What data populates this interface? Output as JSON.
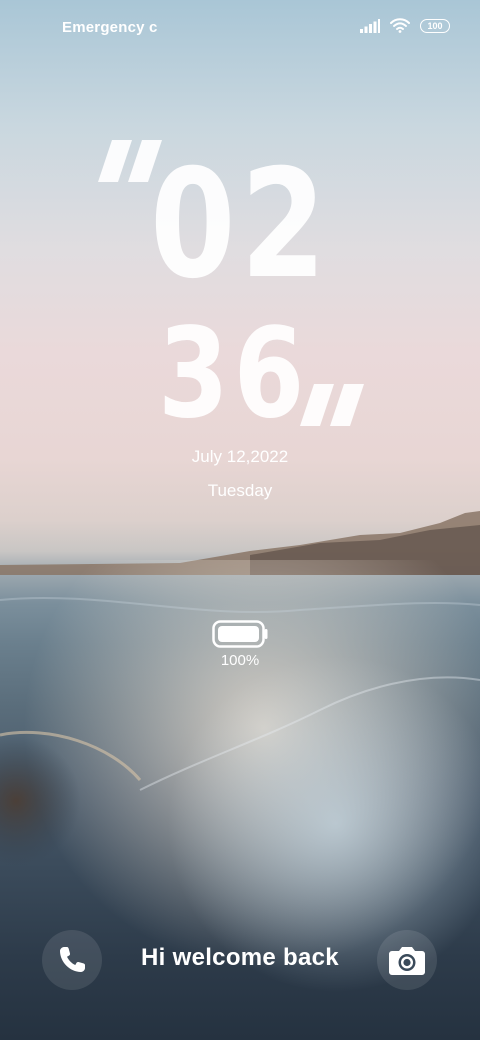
{
  "status_bar": {
    "carrier_text": "Emergency c",
    "battery_level": "100",
    "icons": [
      "signal-icon",
      "wifi-icon",
      "battery-icon"
    ]
  },
  "clock": {
    "hours": "02",
    "minutes": "36"
  },
  "date": {
    "date_text": "July 12,2022",
    "weekday_text": "Tuesday"
  },
  "charging": {
    "percent_text": "100%",
    "level": 1.0
  },
  "bottom_bar": {
    "greeting": "Hi welcome back",
    "left_icon": "phone-icon",
    "right_icon": "camera-icon"
  }
}
